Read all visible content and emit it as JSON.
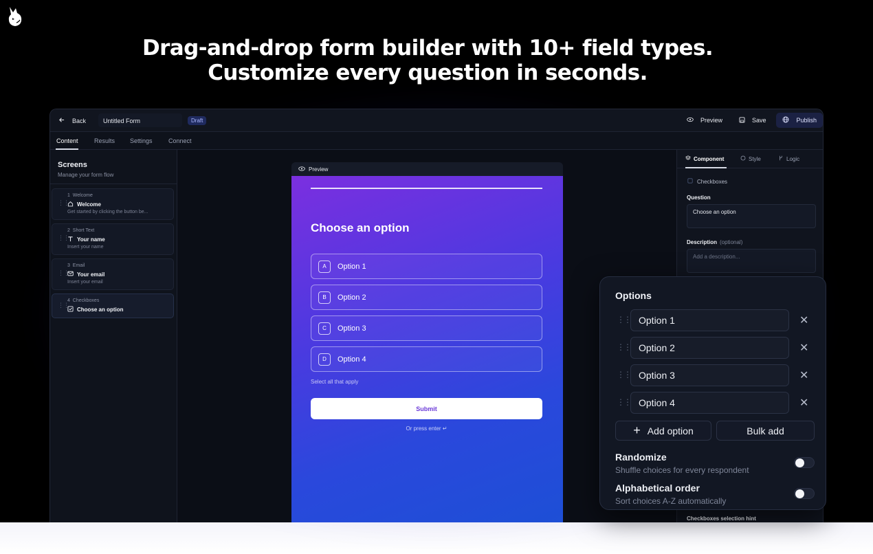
{
  "headline": {
    "line1": "Drag-and-drop form builder with 10+ field types.",
    "line2": "Customize every question in seconds."
  },
  "topbar": {
    "back_label": "Back",
    "form_title": "Untitled Form",
    "status_badge": "Draft",
    "preview_label": "Preview",
    "save_label": "Save",
    "publish_label": "Publish"
  },
  "tabs": [
    "Content",
    "Results",
    "Settings",
    "Connect"
  ],
  "sidebar": {
    "title": "Screens",
    "subtitle": "Manage your form flow",
    "screens": [
      {
        "num": "1",
        "type": "Welcome",
        "name": "Welcome",
        "desc": "Get started by clicking the button be...",
        "icon": "home-icon"
      },
      {
        "num": "2",
        "type": "Short Text",
        "name": "Your name",
        "desc": "Insert your name",
        "icon": "text-icon"
      },
      {
        "num": "3",
        "type": "Email",
        "name": "Your email",
        "desc": "Insert your email",
        "icon": "mail-icon"
      },
      {
        "num": "4",
        "type": "Checkboxes",
        "name": "Choose an option",
        "desc": "",
        "icon": "checkbox-icon"
      }
    ]
  },
  "preview": {
    "bar_label": "Preview",
    "question": "Choose an option",
    "options": [
      {
        "key": "A",
        "label": "Option 1"
      },
      {
        "key": "B",
        "label": "Option 2"
      },
      {
        "key": "C",
        "label": "Option 3"
      },
      {
        "key": "D",
        "label": "Option 4"
      }
    ],
    "hint": "Select all that apply",
    "submit_label": "Submit",
    "press_enter": "Or press enter ↵"
  },
  "panel": {
    "tabs": [
      "Component",
      "Style",
      "Logic"
    ],
    "component_type": "Checkboxes",
    "question_label": "Question",
    "question_value": "Choose an option",
    "description_label": "Description",
    "description_optional": "(optional)",
    "description_placeholder": "Add a description...",
    "bottom_label": "Checkboxes selection hint"
  },
  "options_card": {
    "title": "Options",
    "options": [
      "Option 1",
      "Option 2",
      "Option 3",
      "Option 4"
    ],
    "add_option_label": "Add option",
    "bulk_add_label": "Bulk add",
    "randomize_title": "Randomize",
    "randomize_sub": "Shuffle choices for every respondent",
    "alpha_title": "Alphabetical order",
    "alpha_sub": "Sort choices A-Z automatically"
  }
}
